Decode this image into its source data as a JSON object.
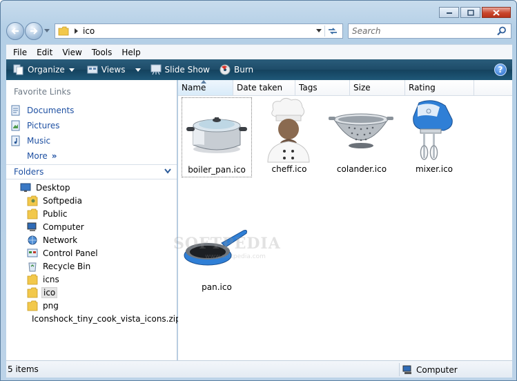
{
  "window": {
    "controls": [
      "minimize",
      "maximize",
      "close"
    ]
  },
  "address": {
    "path": "ico"
  },
  "search": {
    "placeholder": "Search"
  },
  "menu": [
    "File",
    "Edit",
    "View",
    "Tools",
    "Help"
  ],
  "commands": {
    "organize": "Organize",
    "views": "Views",
    "slideshow": "Slide Show",
    "burn": "Burn",
    "help": "?"
  },
  "favorites": {
    "title": "Favorite Links",
    "items": [
      "Documents",
      "Pictures",
      "Music"
    ],
    "more": "More",
    "more_chevron": "»"
  },
  "folders": {
    "title": "Folders",
    "tree": [
      {
        "label": "Desktop",
        "icon": "desktop-icon"
      },
      {
        "label": "Softpedia",
        "icon": "user-folder-icon"
      },
      {
        "label": "Public",
        "icon": "folder-icon"
      },
      {
        "label": "Computer",
        "icon": "computer-icon"
      },
      {
        "label": "Network",
        "icon": "network-icon"
      },
      {
        "label": "Control Panel",
        "icon": "control-panel-icon"
      },
      {
        "label": "Recycle Bin",
        "icon": "recycle-bin-icon"
      },
      {
        "label": "icns",
        "icon": "folder-icon"
      },
      {
        "label": "ico",
        "icon": "folder-icon"
      },
      {
        "label": "png",
        "icon": "folder-icon"
      },
      {
        "label": "Iconshock_tiny_cook_vista_icons.zip",
        "icon": "zip-folder-icon"
      }
    ]
  },
  "columns": [
    "Name",
    "Date taken",
    "Tags",
    "Size",
    "Rating"
  ],
  "files": [
    {
      "name": "boiler_pan.ico",
      "icon": "boiler-pan-icon"
    },
    {
      "name": "cheff.ico",
      "icon": "chef-icon"
    },
    {
      "name": "colander.ico",
      "icon": "colander-icon"
    },
    {
      "name": "mixer.ico",
      "icon": "mixer-icon"
    },
    {
      "name": "pan.ico",
      "icon": "frying-pan-icon"
    }
  ],
  "watermark": {
    "main": "SOFTPEDIA",
    "sub": "www.softpedia.com"
  },
  "status": {
    "count": "5 items",
    "zone": "Computer"
  }
}
